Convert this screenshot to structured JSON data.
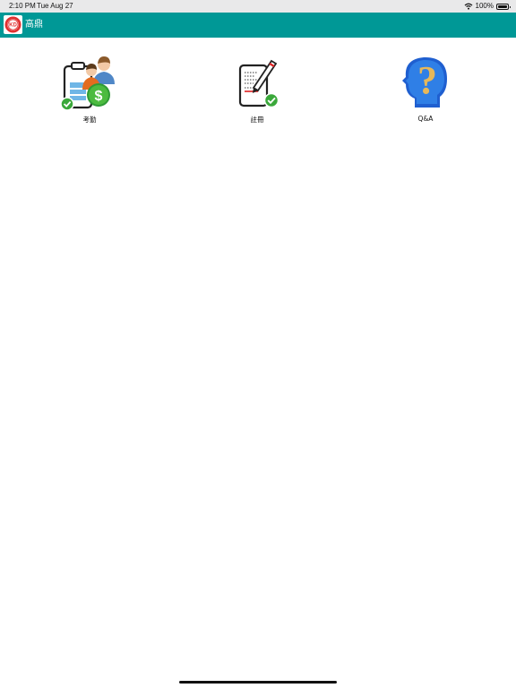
{
  "status_bar": {
    "time": "2:10 PM",
    "date": "Tue Aug 27",
    "battery": "100%",
    "icons": [
      "wifi-icon",
      "battery-icon"
    ]
  },
  "app_bar": {
    "title": "高鼎",
    "logo_text": "KD",
    "color": "#009896"
  },
  "menu": {
    "items": [
      {
        "label": "考勤",
        "icon": "attendance-icon"
      },
      {
        "label": "註冊",
        "icon": "register-icon"
      },
      {
        "label": "Q&A",
        "icon": "question-head-icon"
      }
    ]
  }
}
